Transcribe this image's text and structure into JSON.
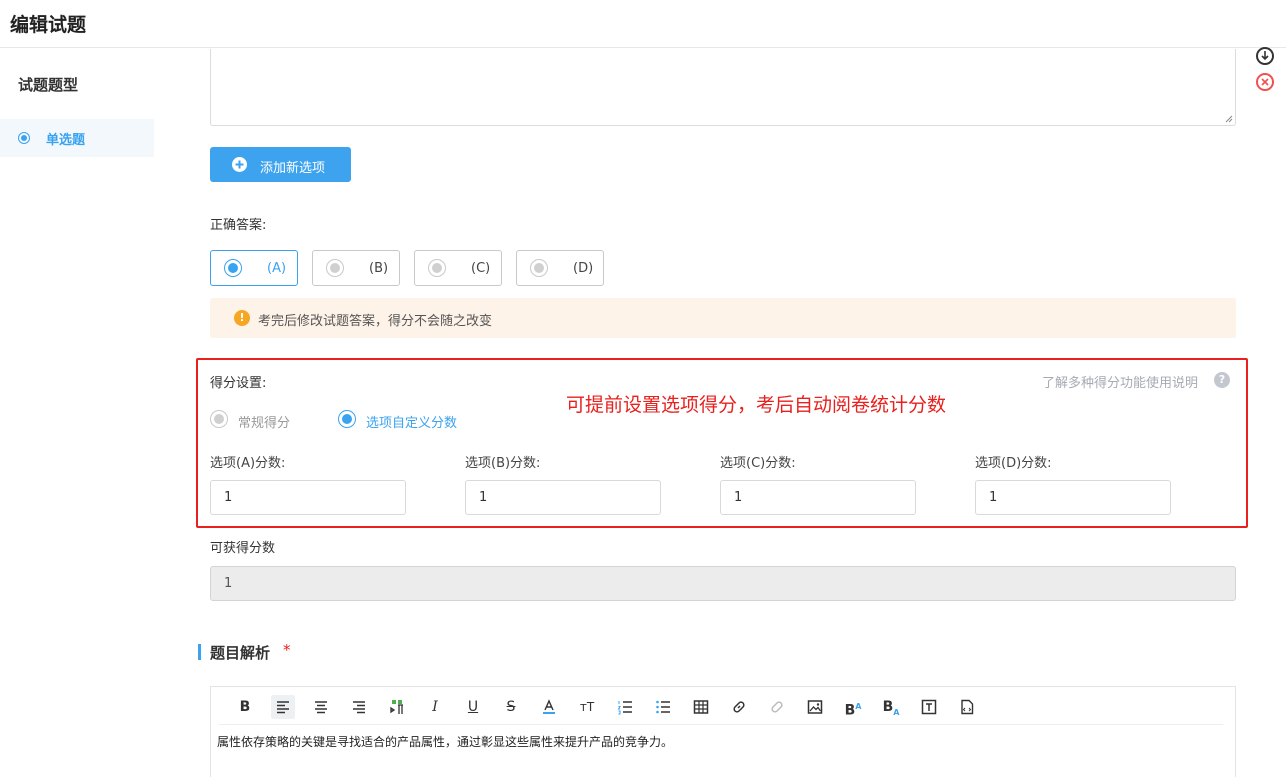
{
  "header": {
    "title": "编辑试题"
  },
  "sidebar": {
    "title": "试题题型",
    "items": [
      {
        "label": "单选题",
        "selected": true
      }
    ]
  },
  "add_option_button": {
    "label": "添加新选项"
  },
  "correct_answer": {
    "label": "正确答案:",
    "options": [
      {
        "label": "(A)",
        "selected": true
      },
      {
        "label": "(B)",
        "selected": false
      },
      {
        "label": "(C)",
        "selected": false
      },
      {
        "label": "(D)",
        "selected": false
      }
    ]
  },
  "warning": {
    "text": "考完后修改试题答案，得分不会随之改变"
  },
  "score_settings": {
    "label": "得分设置:",
    "help_link": "了解多种得分功能使用说明",
    "annotation": "可提前设置选项得分，考后自动阅卷统计分数",
    "modes": [
      {
        "label": "常规得分",
        "selected": false
      },
      {
        "label": "选项自定义分数",
        "selected": true
      }
    ],
    "option_scores": [
      {
        "label": "选项(A)分数:",
        "value": "1"
      },
      {
        "label": "选项(B)分数:",
        "value": "1"
      },
      {
        "label": "选项(C)分数:",
        "value": "1"
      },
      {
        "label": "选项(D)分数:",
        "value": "1"
      }
    ]
  },
  "obtainable_score": {
    "label": "可获得分数",
    "value": "1"
  },
  "analysis": {
    "title": "题目解析",
    "required_mark": "*",
    "toolbar": [
      "bold-icon",
      "align-left-icon",
      "align-center-icon",
      "align-right-icon",
      "text-direction-icon",
      "italic-icon",
      "underline-icon",
      "strikethrough-icon",
      "font-color-icon",
      "font-size-icon",
      "ordered-list-icon",
      "unordered-list-icon",
      "table-icon",
      "link-icon",
      "unlink-icon",
      "image-icon",
      "superscript-icon",
      "subscript-icon",
      "text-box-icon",
      "code-file-icon"
    ],
    "content": "属性依存策略的关键是寻找适合的产品属性，通过彰显这些属性来提升产品的竞争力。"
  },
  "colors": {
    "primary": "#3ea3ef",
    "warning_bg": "#fef3e8",
    "warning_icon": "#f5a623",
    "annotation": "#e8201e"
  }
}
